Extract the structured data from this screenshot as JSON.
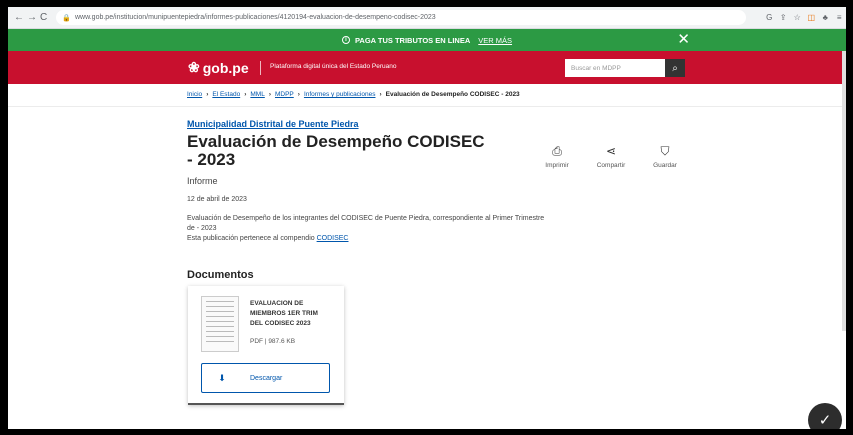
{
  "browser": {
    "url": "www.gob.pe/institucion/munipuentepiedra/informes-publicaciones/4120194-evaluacion-de-desempeno-codisec-2023"
  },
  "banner": {
    "text": "PAGA TUS TRIBUTOS EN LINEA",
    "link": "VER MÁS"
  },
  "header": {
    "logo": "gob.pe",
    "tagline": "Plataforma digital única del Estado Peruano",
    "search_placeholder": "Buscar en MDPP"
  },
  "breadcrumb": [
    "Inicio",
    "El Estado",
    "MML",
    "MDPP",
    "Informes y publicaciones"
  ],
  "breadcrumb_current": "Evaluación de Desempeño CODISEC - 2023",
  "page": {
    "org": "Municipalidad Distrital de Puente Piedra",
    "title": "Evaluación de Desempeño CODISEC - 2023",
    "type": "Informe",
    "date": "12 de abril de 2023",
    "description": "Evaluación de Desempeño de los integrantes del CODISEC de Puente Piedra, correspondiente al Primer Trimestre de - 2023",
    "compendium_text": "Esta publicación pertenece al compendio",
    "compendium_link": "CODISEC"
  },
  "actions": {
    "print": "Imprimir",
    "share": "Compartir",
    "save": "Guardar"
  },
  "documents": {
    "heading": "Documentos",
    "item": {
      "name": "EVALUACION DE MIEMBROS 1ER TRIM DEL CODISEC 2023",
      "format": "PDF",
      "size": "987.6 KB",
      "download_label": "Descargar"
    }
  }
}
